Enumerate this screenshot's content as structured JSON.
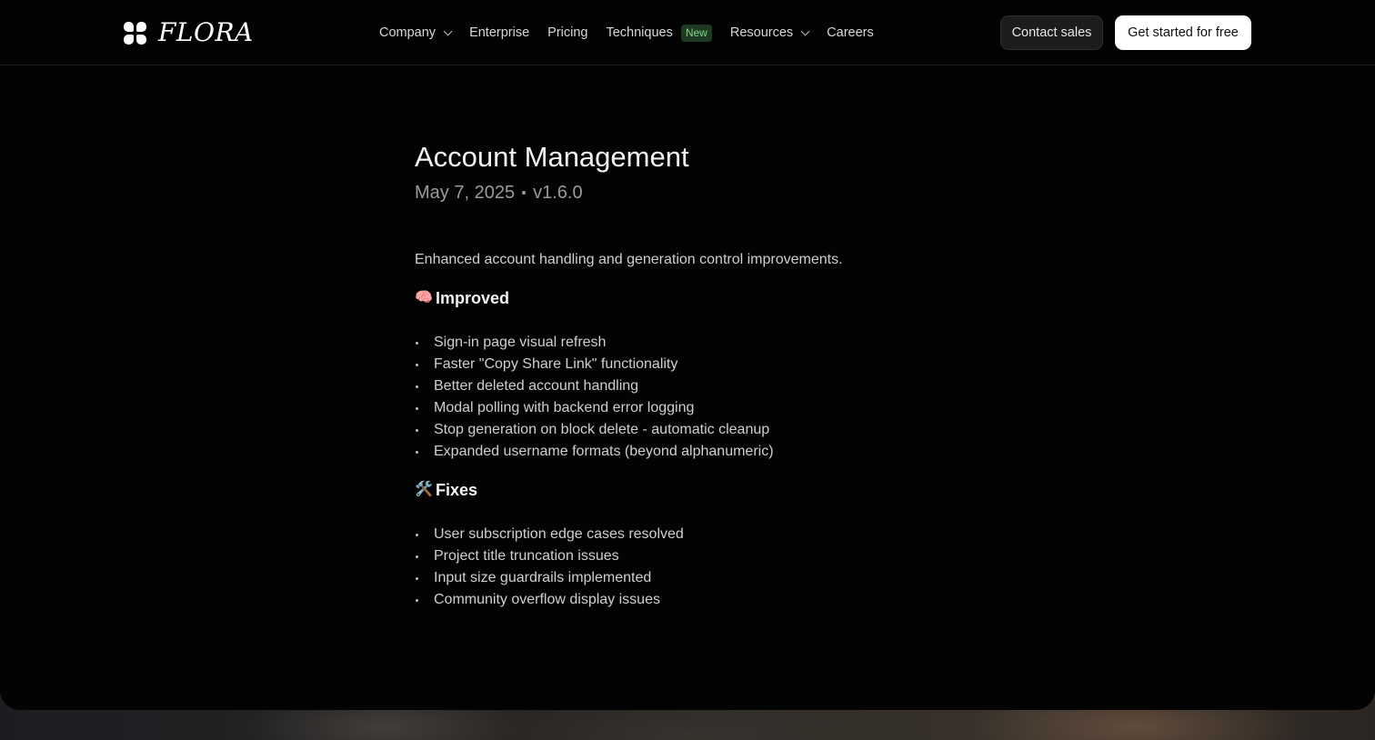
{
  "header": {
    "logo_text": "FLORA",
    "nav": [
      {
        "label": "Company",
        "has_dropdown": true
      },
      {
        "label": "Enterprise",
        "has_dropdown": false
      },
      {
        "label": "Pricing",
        "has_dropdown": false
      },
      {
        "label": "Techniques",
        "has_dropdown": false,
        "badge": "New"
      },
      {
        "label": "Resources",
        "has_dropdown": true
      },
      {
        "label": "Careers",
        "has_dropdown": false
      }
    ],
    "contact_label": "Contact sales",
    "start_label": "Get started for free"
  },
  "post": {
    "title": "Account Management",
    "date": "May 7, 2025",
    "version": "v1.6.0",
    "intro": "Enhanced account handling and generation control improvements.",
    "sections": [
      {
        "emoji": "🧠",
        "heading": "Improved",
        "items": [
          "Sign-in page visual refresh",
          "Faster \"Copy Share Link\" functionality",
          "Better deleted account handling",
          "Modal polling with backend error logging",
          "Stop generation on block delete - automatic cleanup",
          "Expanded username formats (beyond alphanumeric)"
        ]
      },
      {
        "emoji": "🛠️",
        "heading": "Fixes",
        "items": [
          "User subscription edge cases resolved",
          "Project title truncation issues",
          "Input size guardrails implemented",
          "Community overflow display issues"
        ]
      }
    ]
  },
  "colors": {
    "background": "#030303",
    "badge_bg": "#1f3a22",
    "badge_text": "#7fd68a",
    "primary_button": "#ffffff"
  }
}
